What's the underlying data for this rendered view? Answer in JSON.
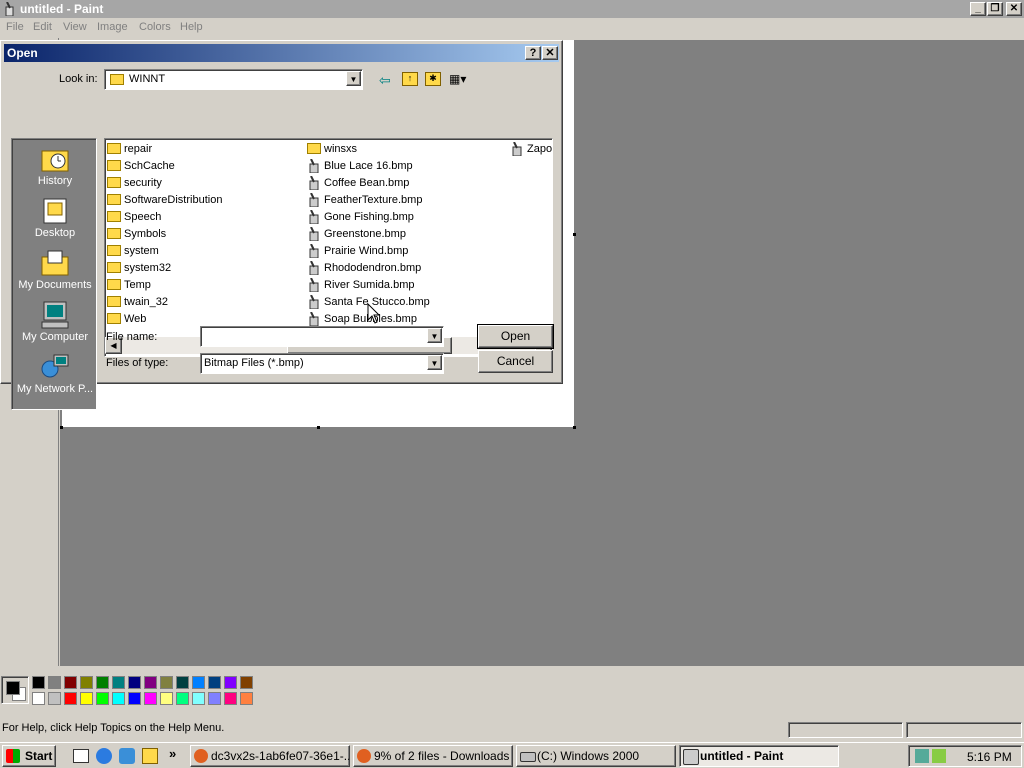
{
  "app": {
    "title": "untitled - Paint",
    "menus": [
      "File",
      "Edit",
      "View",
      "Image",
      "Colors",
      "Help"
    ],
    "status_text": "For Help, click Help Topics on the Help Menu."
  },
  "dialog": {
    "title": "Open",
    "look_in_label": "Look in:",
    "look_in_value": "WINNT",
    "places": [
      "History",
      "Desktop",
      "My Documents",
      "My Computer",
      "My Network P..."
    ],
    "files_col1": [
      "repair",
      "SchCache",
      "security",
      "SoftwareDistribution",
      "Speech",
      "Symbols",
      "system",
      "system32",
      "Temp",
      "twain_32",
      "Web"
    ],
    "files_col2": [
      "winsxs",
      "Blue Lace 16.bmp",
      "Coffee Bean.bmp",
      "FeatherTexture.bmp",
      "Gone Fishing.bmp",
      "Greenstone.bmp",
      "Prairie Wind.bmp",
      "Rhododendron.bmp",
      "River Sumida.bmp",
      "Santa Fe Stucco.bmp",
      "Soap Bubbles.bmp"
    ],
    "files_col3": [
      "Zapot"
    ],
    "file_name_label": "File name:",
    "file_name_value": "",
    "files_of_type_label": "Files of type:",
    "files_of_type_value": "Bitmap Files (*.bmp)",
    "open_label": "Open",
    "cancel_label": "Cancel",
    "help_glyph": "?",
    "close_glyph": "✕"
  },
  "taskbar": {
    "start_label": "Start",
    "chevron": "»",
    "tasks": [
      "dc3vx2s-1ab6fe07-36e1-...",
      "9% of 2 files - Downloads",
      "(C:) Windows 2000",
      "untitled - Paint"
    ],
    "clock": "5:16 PM"
  },
  "colors": {
    "palette_top": [
      "#000000",
      "#808080",
      "#800000",
      "#808000",
      "#008000",
      "#008080",
      "#000080",
      "#800080",
      "#808040",
      "#004040",
      "#0080ff",
      "#004080",
      "#8000ff",
      "#804000"
    ],
    "palette_bottom": [
      "#ffffff",
      "#c0c0c0",
      "#ff0000",
      "#ffff00",
      "#00ff00",
      "#00ffff",
      "#0000ff",
      "#ff00ff",
      "#ffff80",
      "#00ff80",
      "#80ffff",
      "#8080ff",
      "#ff0080",
      "#ff8040"
    ],
    "title_active": "#0a246a",
    "title_inactive": "#a6a6a6"
  }
}
